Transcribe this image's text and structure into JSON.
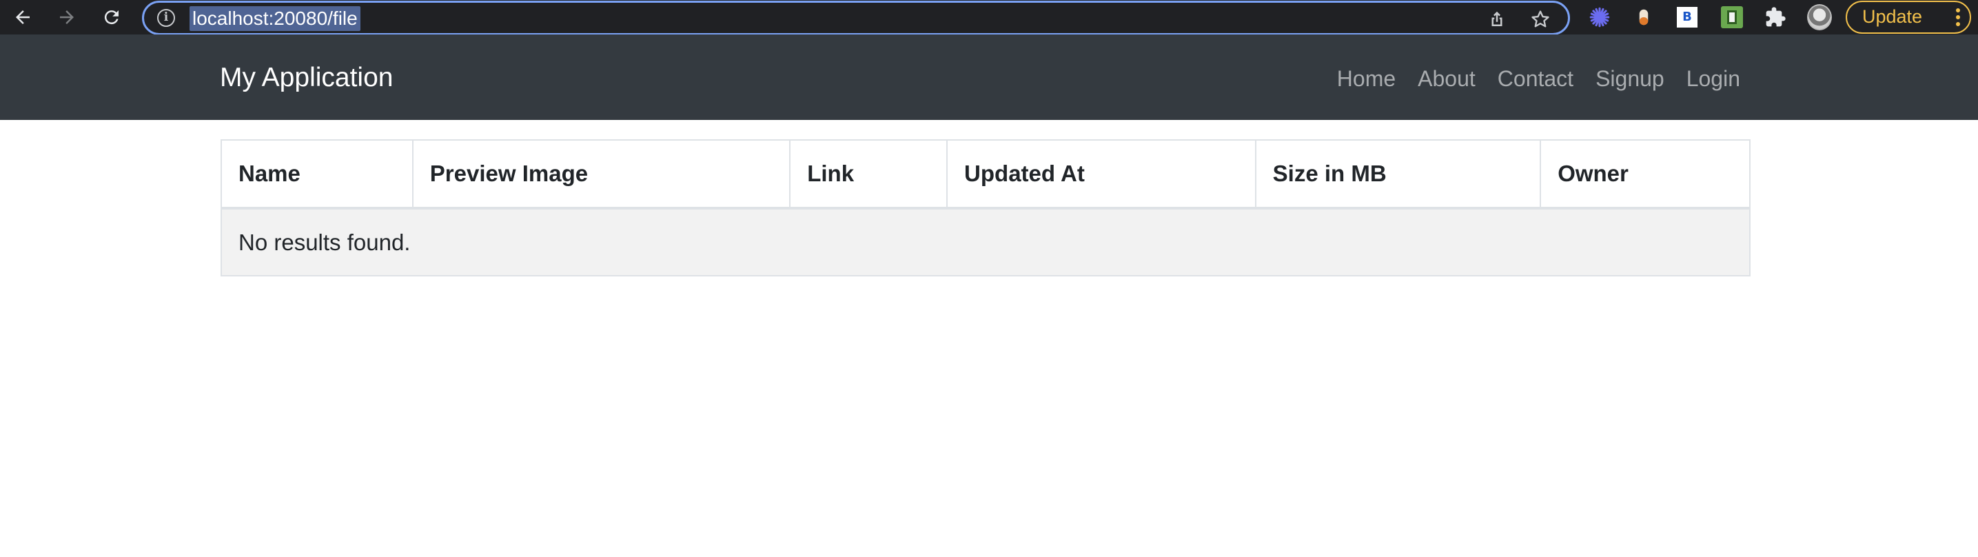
{
  "browser": {
    "url": "localhost:20080/file",
    "update_label": "Update",
    "extension_b_label": "B"
  },
  "navbar": {
    "brand": "My Application",
    "links": [
      "Home",
      "About",
      "Contact",
      "Signup",
      "Login"
    ],
    "background_color": "#343a40"
  },
  "table": {
    "columns": [
      "Name",
      "Preview Image",
      "Link",
      "Updated At",
      "Size in MB",
      "Owner"
    ],
    "empty_message": "No results found."
  },
  "colors": {
    "chrome_bg": "#202124",
    "omnibox_focus": "#7aa1f4",
    "update_accent": "#f2c04b",
    "empty_row_bg": "#f2f2f2"
  },
  "icons": [
    "back-arrow-icon",
    "forward-arrow-icon",
    "reload-icon",
    "info-icon",
    "share-icon",
    "star-icon",
    "extension-icon",
    "puzzle-icon",
    "profile-avatar",
    "more-vert-icon"
  ]
}
